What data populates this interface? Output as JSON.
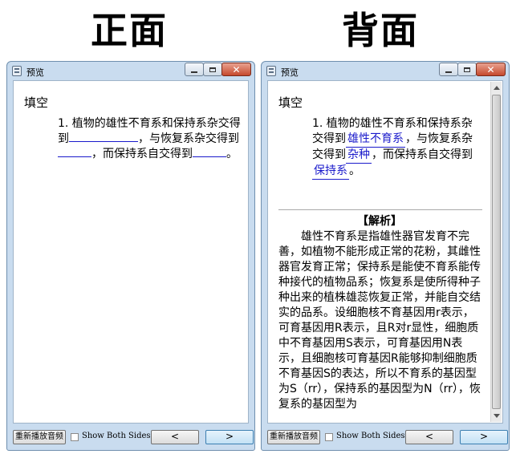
{
  "headings": {
    "front": "正面",
    "back": "背面"
  },
  "window_title": "预览",
  "front": {
    "heading": "填空",
    "q1_prefix": "1.  植物的雄性不育系和保持系杂交得到",
    "q1_mid1": "，与恢复系杂交得到",
    "q1_mid2": "，而保持系自交得到",
    "q1_end": "。"
  },
  "back": {
    "heading": "填空",
    "q1_prefix": "1.  植物的雄性不育系和保持系杂交得到",
    "answer1": "雄性不育系",
    "q1_mid1": "，与恢复系杂交得到",
    "answer2": "杂种",
    "q1_mid2": "，而保持系自交得到",
    "answer3": "保持系",
    "q1_end": "。",
    "analysis_title": "【解析】",
    "analysis_text": "雄性不育系是指雄性器官发育不完善，如植物不能形成正常的花粉，其雌性器官发育正常；保持系是能使不育系能传种接代的植物品系；恢复系是使所得种子种出来的植株雄蕊恢复正常，并能自交结实的品系。设细胞核不育基因用r表示，可育基因用R表示，且R对r显性，细胞质中不育基因用S表示，可育基因用N表示，且细胞核可育基因R能够抑制细胞质不育基因S的表达，所以不育系的基因型为S（rr），保持系的基因型为N（rr），恢复系的基因型为"
  },
  "bottom": {
    "replay_label": "重新播放音频",
    "show_both_label": "Show Both Sides",
    "prev_label": "<",
    "next_label": ">"
  }
}
